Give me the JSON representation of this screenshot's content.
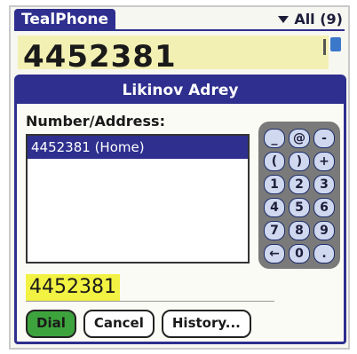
{
  "title_bar": {
    "app_title": "TealPhone",
    "category": "All (9)"
  },
  "lookup": {
    "text": "4452381"
  },
  "dialog": {
    "title": "Likinov Adrey",
    "field_label": "Number/Address:",
    "list_items": [
      "4452381 (Home)"
    ],
    "keypad": [
      "_",
      "@",
      "-",
      "(",
      ")",
      "+",
      "1",
      "2",
      "3",
      "4",
      "5",
      "6",
      "7",
      "8",
      "9",
      "←",
      "0",
      "."
    ],
    "number_value": "4452381",
    "buttons": {
      "dial": "Dial",
      "cancel": "Cancel",
      "history": "History..."
    }
  },
  "colors": {
    "header": "#2e2f8e",
    "dial_button": "#3da33d",
    "highlight": "#f2f243"
  }
}
